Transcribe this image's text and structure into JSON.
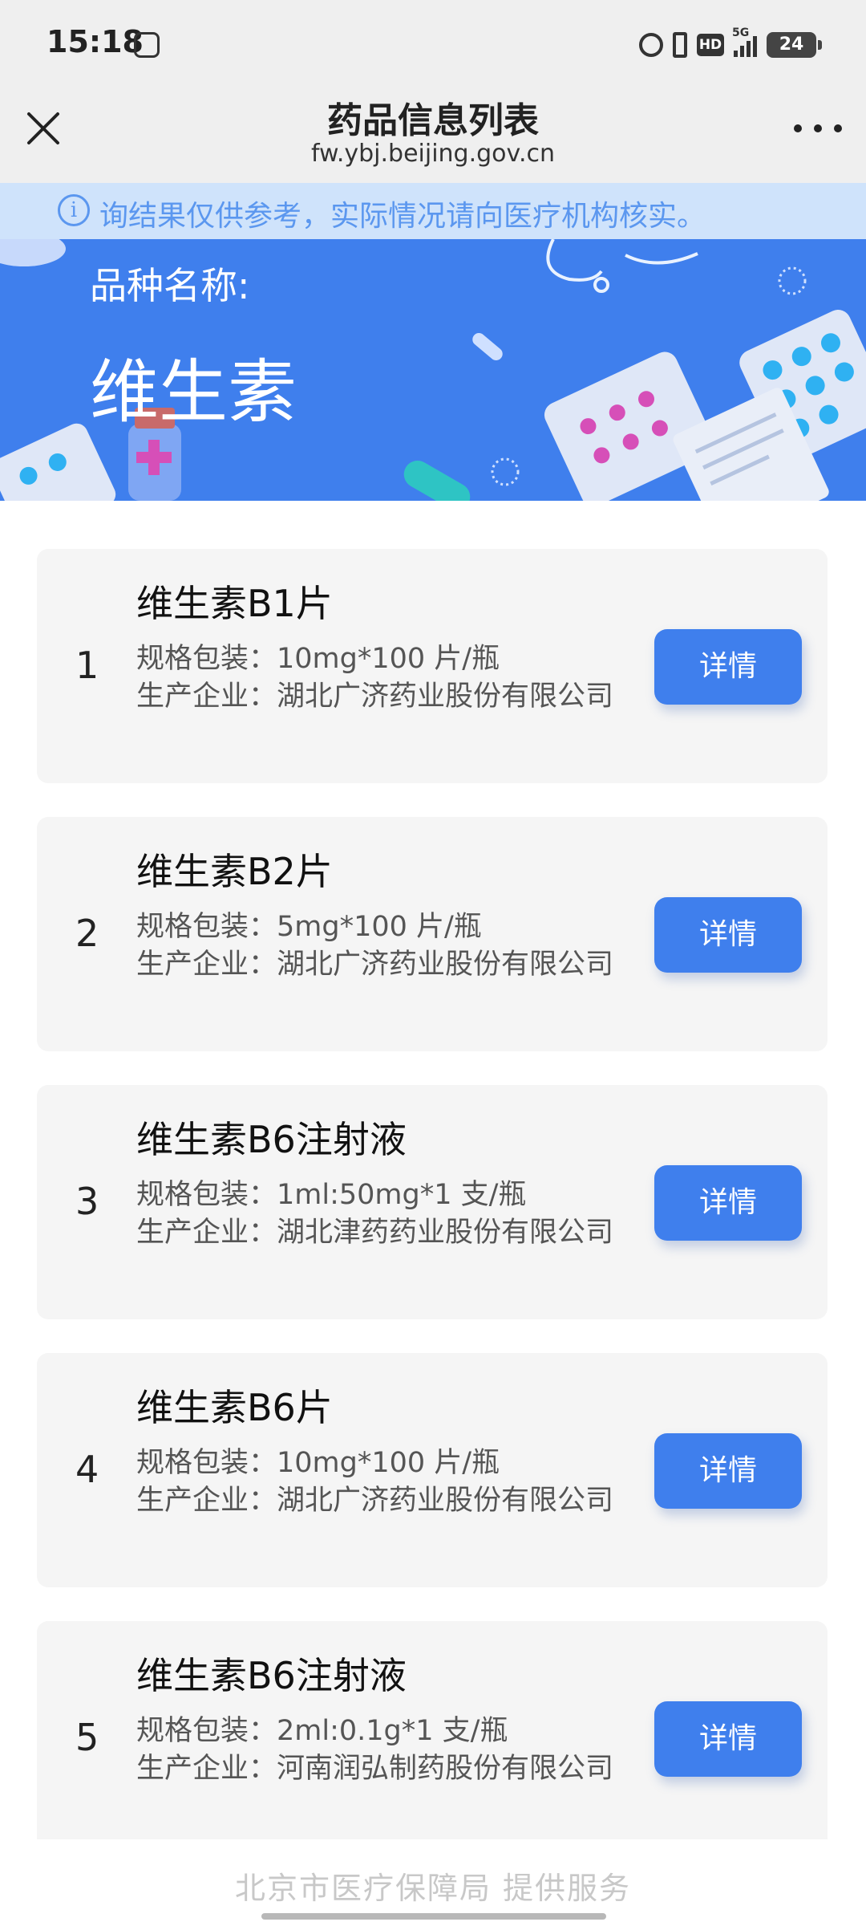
{
  "status_bar": {
    "time": "15:18",
    "hd": "HD",
    "network": "5G",
    "battery": "24",
    "icons": [
      "app-notification-icon",
      "alarm-icon",
      "vibrate-icon",
      "hd-icon",
      "signal-icon",
      "battery-icon"
    ]
  },
  "title_bar": {
    "title": "药品信息列表",
    "url": "fw.ybj.beijing.gov.cn",
    "close_icon": "close-icon",
    "more_icon": "more-icon"
  },
  "notice": {
    "icon": "info-icon",
    "text": "询结果仅供参考，实际情况请向医疗机构核实。"
  },
  "banner": {
    "label": "品种名称:",
    "name": "维生素",
    "background_color": "#3f7fed"
  },
  "drugs": [
    {
      "index": "1",
      "name": "维生素B1片",
      "spec": "规格包装：10mg*100 片/瓶",
      "maker": "生产企业：湖北广济药业股份有限公司",
      "button": "详情"
    },
    {
      "index": "2",
      "name": "维生素B2片",
      "spec": "规格包装：5mg*100 片/瓶",
      "maker": "生产企业：湖北广济药业股份有限公司",
      "button": "详情"
    },
    {
      "index": "3",
      "name": "维生素B6注射液",
      "spec": "规格包装：1ml:50mg*1 支/瓶",
      "maker": "生产企业：湖北津药药业股份有限公司",
      "button": "详情"
    },
    {
      "index": "4",
      "name": "维生素B6片",
      "spec": "规格包装：10mg*100 片/瓶",
      "maker": "生产企业：湖北广济药业股份有限公司",
      "button": "详情"
    },
    {
      "index": "5",
      "name": "维生素B6注射液",
      "spec": "规格包装：2ml:0.1g*1 支/瓶",
      "maker": "生产企业：河南润弘制药股份有限公司",
      "button": "详情"
    }
  ],
  "footer": {
    "text": "北京市医疗保障局  提供服务"
  },
  "colors": {
    "accent": "#3f7fed",
    "notice_bg": "#cfe3fb",
    "notice_text": "#5b97ef",
    "card_bg": "#f5f5f5"
  }
}
